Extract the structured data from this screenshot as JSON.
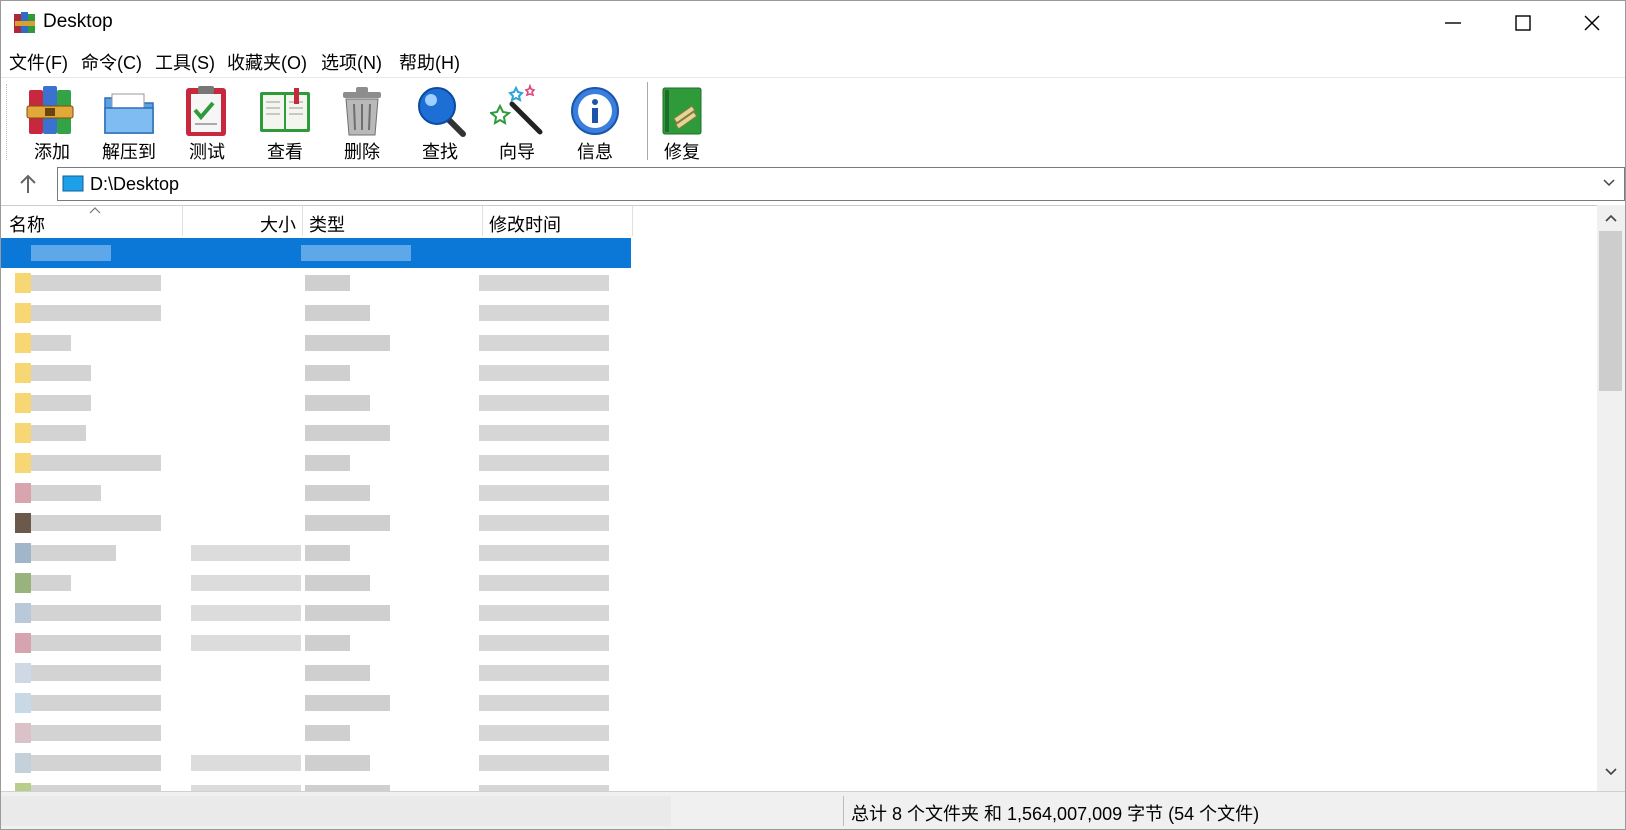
{
  "window": {
    "title": "Desktop"
  },
  "menu": [
    {
      "label": "文件(F)"
    },
    {
      "label": "命令(C)"
    },
    {
      "label": "工具(S)"
    },
    {
      "label": "收藏夹(O)"
    },
    {
      "label": "选项(N)"
    },
    {
      "label": "帮助(H)"
    }
  ],
  "toolbar": {
    "buttons": [
      {
        "label": "添加",
        "icon": "books-archive-icon"
      },
      {
        "label": "解压到",
        "icon": "folder-extract-icon"
      },
      {
        "label": "测试",
        "icon": "clipboard-check-icon"
      },
      {
        "label": "查看",
        "icon": "open-book-icon"
      },
      {
        "label": "删除",
        "icon": "trash-can-icon"
      },
      {
        "label": "查找",
        "icon": "magnifier-icon"
      },
      {
        "label": "向导",
        "icon": "magic-wand-icon"
      },
      {
        "label": "信息",
        "icon": "info-icon"
      },
      {
        "label": "修复",
        "icon": "repair-book-icon"
      }
    ]
  },
  "address": {
    "path": "D:\\Desktop"
  },
  "columns": {
    "name": "名称",
    "size": "大小",
    "type": "类型",
    "modified": "修改时间"
  },
  "status": {
    "summary": "总计 8 个文件夹 和 1,564,007,009 字节 (54 个文件)"
  },
  "colors": {
    "selection": "#0b78d7",
    "folder": "#f7d774",
    "blurred": "#d9d9d9"
  }
}
